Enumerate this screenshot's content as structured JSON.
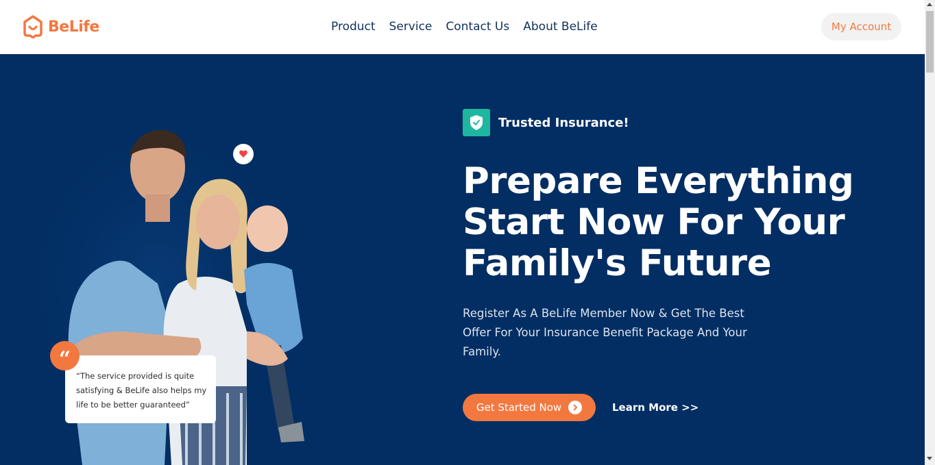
{
  "brand": {
    "name": "BeLife",
    "logo_icon": "house-pin-icon",
    "accent": "#f37840"
  },
  "nav": {
    "items": [
      {
        "label": "Product"
      },
      {
        "label": "Service"
      },
      {
        "label": "Contact Us"
      },
      {
        "label": "About BeLife"
      }
    ],
    "account_label": "My Account"
  },
  "hero": {
    "background": "#022e63",
    "badge_icon": "shield-check-icon",
    "badge_text": "Trusted Insurance!",
    "headline_lines": [
      "Prepare Everything",
      "Start Now For Your",
      "Family's Future"
    ],
    "subtitle": "Register As A BeLife Member Now & Get The Best Offer For Your Insurance Benefit Package And Your Family.",
    "cta_label": "Get Started Now",
    "cta_icon": "chevron-right-circle-icon",
    "learn_more_label": "Learn More >>",
    "testimonial": {
      "icon": "quote-icon",
      "glyph": "“",
      "text": "“The service provided is quite satisfying & BeLife also helps my life to be better guaranteed”"
    },
    "heart_icon": "heart-icon",
    "photo": "family-photo"
  }
}
